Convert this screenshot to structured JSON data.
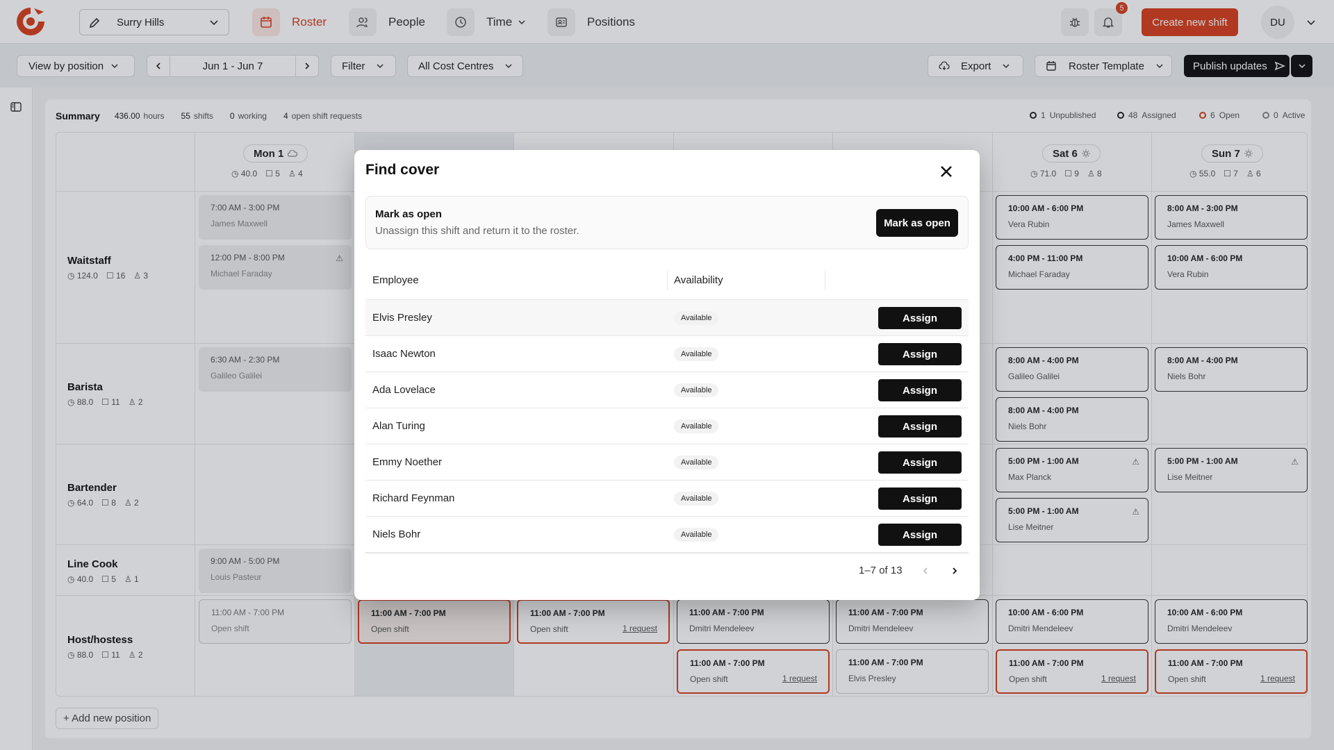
{
  "header": {
    "location": "Surry Hills",
    "nav": [
      {
        "label": "Roster",
        "icon": "calendar-icon",
        "active": true
      },
      {
        "label": "People",
        "icon": "people-icon",
        "active": false
      },
      {
        "label": "Time",
        "icon": "clock-icon",
        "active": false
      },
      {
        "label": "Positions",
        "icon": "id-card-icon",
        "active": false
      }
    ],
    "notification_count": "5",
    "create_label": "Create new shift",
    "avatar_initials": "DU"
  },
  "toolbar": {
    "view_by": "View by position",
    "date_range": "Jun 1 - Jun 7",
    "filter": "Filter",
    "cost_centres": "All Cost Centres",
    "export": "Export",
    "roster_template": "Roster Template",
    "publish": "Publish updates"
  },
  "summary": {
    "label": "Summary",
    "hours_value": "436.00",
    "hours_unit": "hours",
    "shifts_value": "55",
    "shifts_unit": "shifts",
    "working_value": "0",
    "working_unit": "working",
    "requests_value": "4",
    "requests_unit": "open shift requests",
    "statuses": [
      {
        "count": "1",
        "label": "Unpublished",
        "color": "#222222"
      },
      {
        "count": "48",
        "label": "Assigned",
        "color": "#222222"
      },
      {
        "count": "6",
        "label": "Open",
        "color": "#d9401f"
      },
      {
        "count": "0",
        "label": "Active",
        "color": "#888888"
      }
    ]
  },
  "days": [
    {
      "label": "Mon 1",
      "hours": "40.0",
      "shifts": "5",
      "people": "4"
    },
    {
      "label": "Sat 6",
      "hours": "71.0",
      "shifts": "9",
      "people": "8"
    },
    {
      "label": "Sun 7",
      "hours": "55.0",
      "shifts": "7",
      "people": "6"
    }
  ],
  "positions": [
    {
      "name": "Waitstaff",
      "hours": "124.0",
      "shifts": "16",
      "people": "3"
    },
    {
      "name": "Barista",
      "hours": "88.0",
      "shifts": "11",
      "people": "2"
    },
    {
      "name": "Bartender",
      "hours": "64.0",
      "shifts": "8",
      "people": "2"
    },
    {
      "name": "Line Cook",
      "hours": "40.0",
      "shifts": "5",
      "people": "1"
    },
    {
      "name": "Host/hostess",
      "hours": "88.0",
      "shifts": "11",
      "people": "2"
    }
  ],
  "shifts": {
    "mon_w1": {
      "time": "7:00 AM - 3:00 PM",
      "name": "James Maxwell"
    },
    "mon_w2": {
      "time": "12:00 PM - 8:00 PM",
      "name": "Michael Faraday"
    },
    "mon_b1": {
      "time": "6:30 AM - 2:30 PM",
      "name": "Galileo Galilei"
    },
    "mon_l1": {
      "time": "9:00 AM - 5:00 PM",
      "name": "Louis Pasteur"
    },
    "mon_h1": {
      "time": "11:00 AM - 7:00 PM",
      "name": "Open shift"
    },
    "tue_h1": {
      "time": "11:00 AM - 7:00 PM",
      "name": "Open shift"
    },
    "wed_h1": {
      "time": "11:00 AM - 7:00 PM",
      "name": "Open shift",
      "req": "1 request"
    },
    "thu_h1": {
      "time": "11:00 AM - 7:00 PM",
      "name": "Dmitri Mendeleev"
    },
    "thu_h2": {
      "time": "11:00 AM - 7:00 PM",
      "name": "Open shift",
      "req": "1 request"
    },
    "fri_h1": {
      "time": "11:00 AM - 7:00 PM",
      "name": "Dmitri Mendeleev"
    },
    "fri_h2": {
      "time": "11:00 AM - 7:00 PM",
      "name": "Elvis Presley"
    },
    "sat_w1": {
      "time": "10:00 AM - 6:00 PM",
      "name": "Vera Rubin"
    },
    "sat_w2": {
      "time": "4:00 PM - 11:00 PM",
      "name": "Michael Faraday"
    },
    "sat_b1": {
      "time": "8:00 AM - 4:00 PM",
      "name": "Galileo Galilei"
    },
    "sat_b2": {
      "time": "8:00 AM - 4:00 PM",
      "name": "Niels Bohr"
    },
    "sat_t1": {
      "time": "5:00 PM - 1:00 AM",
      "name": "Max Planck"
    },
    "sat_t2": {
      "time": "5:00 PM - 1:00 AM",
      "name": "Lise Meitner"
    },
    "sat_h1": {
      "time": "10:00 AM - 6:00 PM",
      "name": "Dmitri Mendeleev"
    },
    "sat_h2": {
      "time": "11:00 AM - 7:00 PM",
      "name": "Open shift",
      "req": "1 request"
    },
    "sun_w1": {
      "time": "8:00 AM - 3:00 PM",
      "name": "James Maxwell"
    },
    "sun_w2": {
      "time": "10:00 AM - 6:00 PM",
      "name": "Vera Rubin"
    },
    "sun_b1": {
      "time": "8:00 AM - 4:00 PM",
      "name": "Niels Bohr"
    },
    "sun_t1": {
      "time": "5:00 PM - 1:00 AM",
      "name": "Lise Meitner"
    },
    "sun_h1": {
      "time": "10:00 AM - 6:00 PM",
      "name": "Dmitri Mendeleev"
    },
    "sun_h2": {
      "time": "11:00 AM - 7:00 PM",
      "name": "Open shift",
      "req": "1 request"
    }
  },
  "add_position": "+ Add new position",
  "modal": {
    "title": "Find cover",
    "mark_title": "Mark as open",
    "mark_desc": "Unassign this shift and return it to the roster.",
    "mark_button": "Mark as open",
    "col_employee": "Employee",
    "col_availability": "Availability",
    "assign_label": "Assign",
    "rows": [
      {
        "name": "Elvis Presley",
        "availability": "Available"
      },
      {
        "name": "Isaac Newton",
        "availability": "Available"
      },
      {
        "name": "Ada Lovelace",
        "availability": "Available"
      },
      {
        "name": "Alan Turing",
        "availability": "Available"
      },
      {
        "name": "Emmy Noether",
        "availability": "Available"
      },
      {
        "name": "Richard Feynman",
        "availability": "Available"
      },
      {
        "name": "Niels Bohr",
        "availability": "Available"
      }
    ],
    "pagination": "1–7 of 13"
  },
  "colors": {
    "brand": "#d9401f",
    "dark": "#111111"
  }
}
